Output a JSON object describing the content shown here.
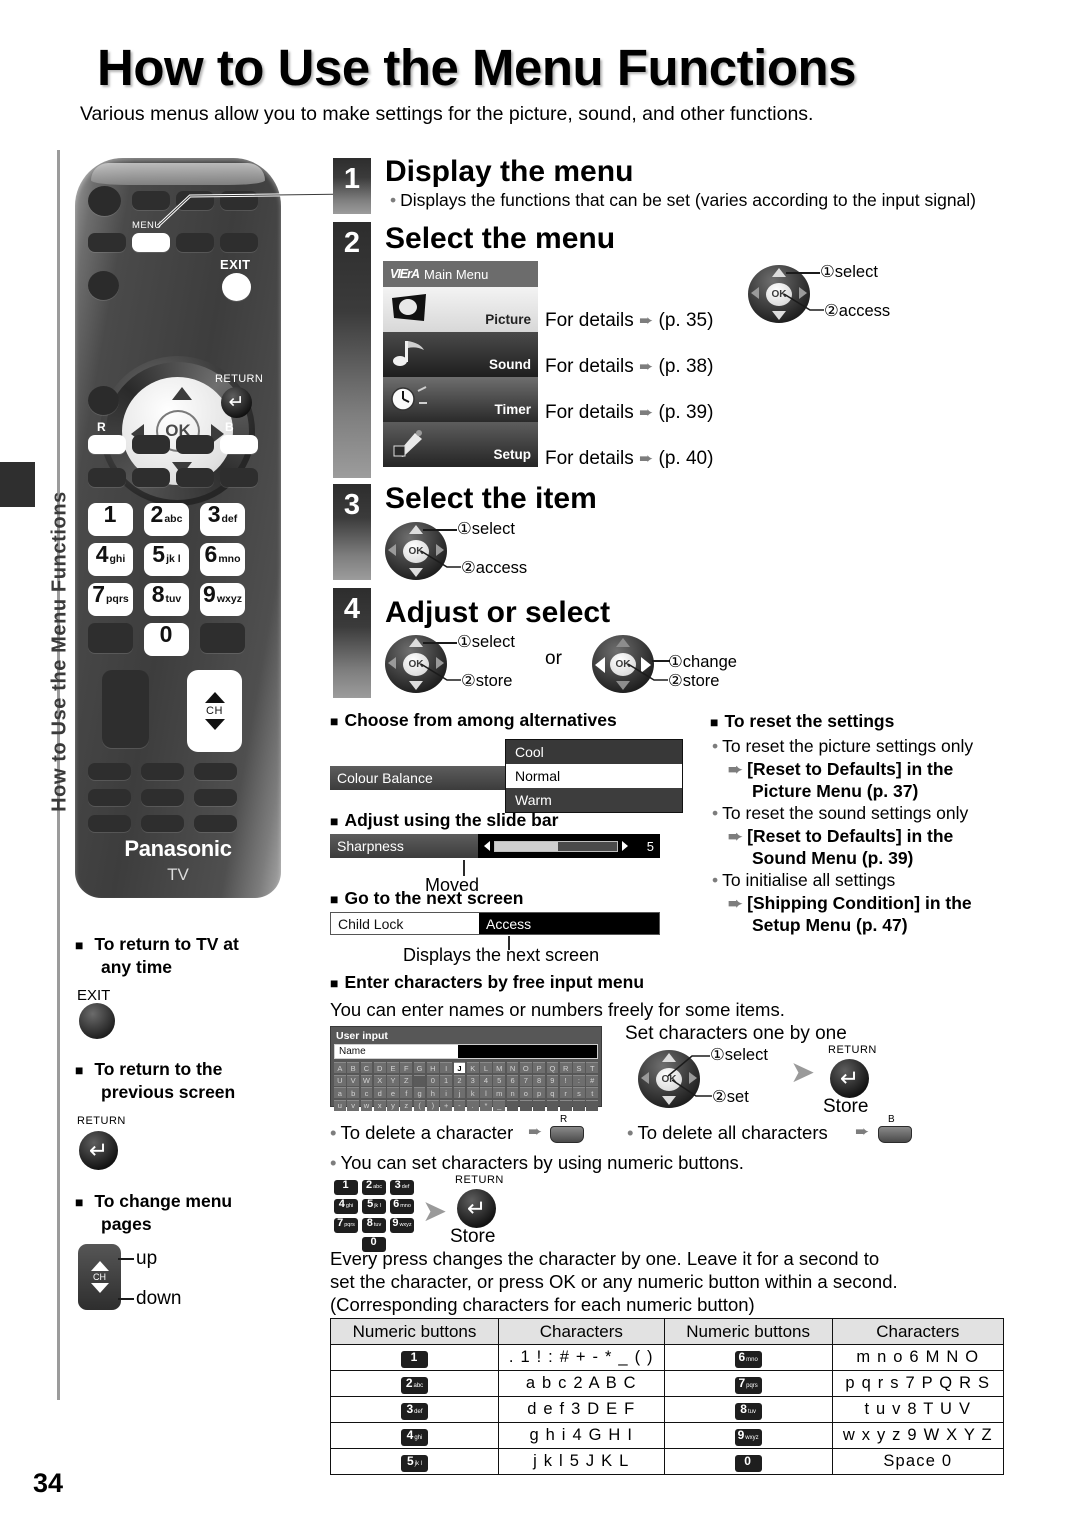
{
  "page": {
    "title": "How to Use the Menu Functions",
    "subtitle": "Various menus allow you to make settings for the picture, sound, and other functions.",
    "side_tab_label": "How to Use the Menu Functions",
    "page_number": "34"
  },
  "remote": {
    "menu_label": "MENU",
    "exit_label": "EXIT",
    "return_label": "RETURN",
    "red_label": "R",
    "blue_label": "B",
    "ok_label": "OK",
    "ch_label": "CH",
    "brand": "Panasonic",
    "brand_sub": "TV",
    "numeric_keys": [
      {
        "digit": "1",
        "letters": ""
      },
      {
        "digit": "2",
        "letters": "abc"
      },
      {
        "digit": "3",
        "letters": "def"
      },
      {
        "digit": "4",
        "letters": "ghi"
      },
      {
        "digit": "5",
        "letters": "jk l"
      },
      {
        "digit": "6",
        "letters": "mno"
      },
      {
        "digit": "7",
        "letters": "pqrs"
      },
      {
        "digit": "8",
        "letters": "tuv"
      },
      {
        "digit": "9",
        "letters": "wxyz"
      },
      {
        "digit": "0",
        "letters": ""
      }
    ]
  },
  "steps": {
    "s1": {
      "num": "1",
      "title": "Display the menu",
      "note": "Displays the functions that can be set (varies according to the input signal)"
    },
    "s2": {
      "num": "2",
      "title": "Select the menu",
      "cue1": "select",
      "cue2": "access"
    },
    "s3": {
      "num": "3",
      "title": "Select the item",
      "cue1": "select",
      "cue2": "access"
    },
    "s4": {
      "num": "4",
      "title": "Adjust or select",
      "cue1": "select",
      "cue2": "store",
      "or": "or",
      "cue3": "change",
      "cue4": "store"
    }
  },
  "main_menu": {
    "logo": "VIErA",
    "header": "Main Menu",
    "rows": [
      {
        "label": "Picture",
        "detail": "For details",
        "page": "(p. 35)"
      },
      {
        "label": "Sound",
        "detail": "For details",
        "page": "(p. 38)"
      },
      {
        "label": "Timer",
        "detail": "For details",
        "page": "(p. 39)"
      },
      {
        "label": "Setup",
        "detail": "For details",
        "page": "(p. 40)"
      }
    ]
  },
  "alternatives": {
    "heading": "Choose from among alternatives",
    "row_label": "Colour Balance",
    "options": [
      "Cool",
      "Normal",
      "Warm"
    ]
  },
  "slidebar": {
    "heading": "Adjust using the slide bar",
    "row_label": "Sharpness",
    "value": "5",
    "caption": "Moved"
  },
  "nextscreen": {
    "heading": "Go to the next screen",
    "row_label": "Child Lock",
    "action": "Access",
    "caption": "Displays the next screen"
  },
  "reset": {
    "heading": "To reset the settings",
    "items": [
      {
        "text": "To reset the picture settings only",
        "target": "[Reset to Defaults] in the",
        "target2": "Picture Menu (p. 37)"
      },
      {
        "text": "To reset the sound settings only",
        "target": "[Reset to Defaults] in the",
        "target2": "Sound Menu (p. 39)"
      },
      {
        "text": "To initialise all settings",
        "target": "[Shipping Condition] in the",
        "target2": "Setup Menu (p. 47)"
      }
    ]
  },
  "freeinput": {
    "heading": "Enter characters by free input menu",
    "intro": "You can enter names or numbers freely for some items.",
    "panel_title": "User input",
    "field_label": "Name",
    "kb_rows": [
      [
        "A",
        "B",
        "C",
        "D",
        "E",
        "F",
        "G",
        "H",
        "I",
        "J",
        "K",
        "L",
        "M",
        "N",
        "O",
        "P",
        "Q",
        "R",
        "S",
        "T"
      ],
      [
        "U",
        "V",
        "W",
        "X",
        "Y",
        "Z",
        "",
        "0",
        "1",
        "2",
        "3",
        "4",
        "5",
        "6",
        "7",
        "8",
        "9",
        "!",
        ":",
        "#"
      ],
      [
        "a",
        "b",
        "c",
        "d",
        "e",
        "f",
        "g",
        "h",
        "i",
        "j",
        "k",
        "l",
        "m",
        "n",
        "o",
        "p",
        "q",
        "r",
        "s",
        "t"
      ],
      [
        "u",
        "v",
        "w",
        "x",
        "y",
        "z",
        "(",
        ")",
        "+",
        "-",
        ".",
        "*",
        "_",
        "",
        "",
        "",
        "",
        "",
        "",
        ""
      ]
    ],
    "kb_selected": "J",
    "set_chars": "Set characters one by one",
    "cue1": "select",
    "cue2": "set",
    "return_label": "RETURN",
    "store": "Store",
    "delete_one": "To delete a character",
    "delete_one_key": "R",
    "delete_all": "To delete all characters",
    "delete_all_key": "B",
    "numeric_note": "You can set characters by using numeric buttons.",
    "numeric_store_return": "RETURN",
    "numeric_store": "Store",
    "explain1": "Every press changes the character by one. Leave it for a second to",
    "explain2": "set the character, or press OK or any numeric button within a second.",
    "explain3": "(Corresponding characters for each numeric button)"
  },
  "char_table": {
    "headers": [
      "Numeric buttons",
      "Characters",
      "Numeric buttons",
      "Characters"
    ],
    "rows": [
      {
        "k1": "1",
        "s1": "",
        "c1": ". 1 ! : # + - * _ ( )",
        "k2": "6",
        "s2": "mno",
        "c2": "m n o 6 M N O"
      },
      {
        "k1": "2",
        "s1": "abc",
        "c1": "a b c 2 A B C",
        "k2": "7",
        "s2": "pqrs",
        "c2": "p q r s 7 P Q R S"
      },
      {
        "k1": "3",
        "s1": "def",
        "c1": "d e f 3 D E F",
        "k2": "8",
        "s2": "tuv",
        "c2": "t u v 8 T U V"
      },
      {
        "k1": "4",
        "s1": "ghi",
        "c1": "g h i 4 G H I",
        "k2": "9",
        "s2": "wxyz",
        "c2": "w x y z 9 W X Y Z"
      },
      {
        "k1": "5",
        "s1": "jk l",
        "c1": "j k l 5 J K L",
        "k2": "0",
        "s2": "",
        "c2": "Space 0"
      }
    ]
  },
  "left_notes": {
    "n1_heading_a": "To return to TV at",
    "n1_heading_b": "any time",
    "n1_key": "EXIT",
    "n2_heading_a": "To return to the",
    "n2_heading_b": "previous screen",
    "n2_key": "RETURN",
    "n3_heading_a": "To change menu",
    "n3_heading_b": "pages",
    "n3_ch": "CH",
    "n3_up": "up",
    "n3_down": "down"
  }
}
